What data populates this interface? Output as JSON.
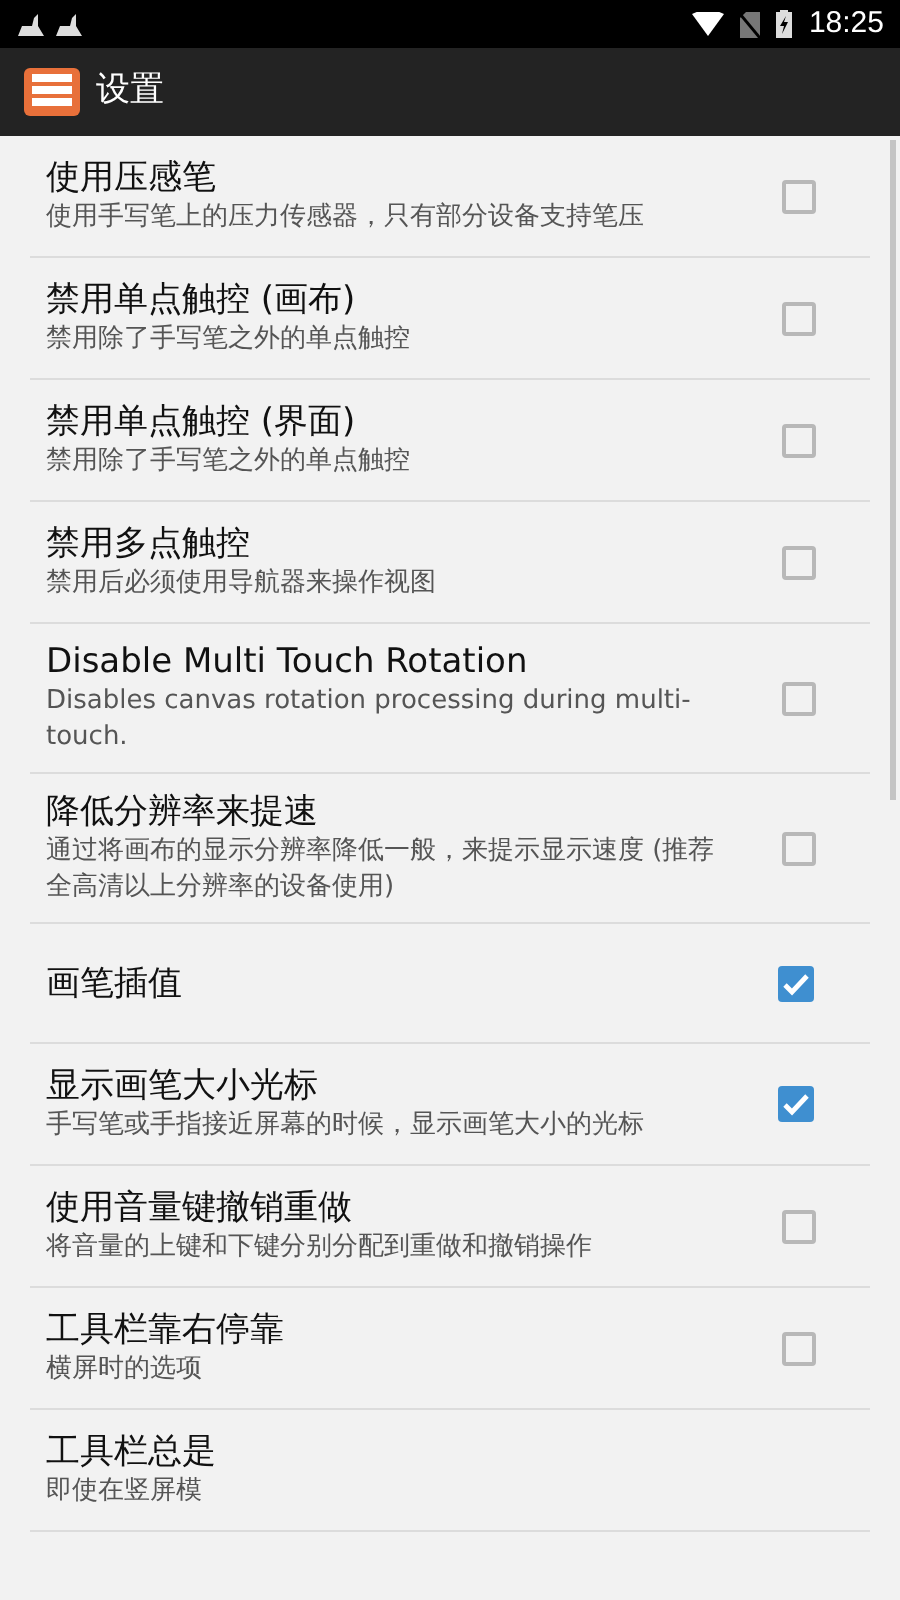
{
  "status_bar": {
    "time": "18:25"
  },
  "app_bar": {
    "title": "设置"
  },
  "settings": [
    {
      "title": "使用压感笔",
      "summary": "使用手写笔上的压力传感器，只有部分设备支持笔压",
      "checked": false
    },
    {
      "title": "禁用单点触控 (画布)",
      "summary": "禁用除了手写笔之外的单点触控",
      "checked": false
    },
    {
      "title": "禁用单点触控 (界面)",
      "summary": "禁用除了手写笔之外的单点触控",
      "checked": false
    },
    {
      "title": "禁用多点触控",
      "summary": "禁用后必须使用导航器来操作视图",
      "checked": false
    },
    {
      "title": "Disable Multi Touch Rotation",
      "summary": "Disables canvas rotation processing during multi-touch.",
      "checked": false
    },
    {
      "title": "降低分辨率来提速",
      "summary": "通过将画布的显示分辨率降低一般，来提示显示速度 (推荐全高清以上分辨率的设备使用)",
      "checked": false
    },
    {
      "title": "画笔插值",
      "checked": true
    },
    {
      "title": "显示画笔大小光标",
      "summary": "手写笔或手指接近屏幕的时候，显示画笔大小的光标",
      "checked": true
    },
    {
      "title": "使用音量键撤销重做",
      "summary": "将音量的上键和下键分别分配到重做和撤销操作",
      "checked": false
    },
    {
      "title": "工具栏靠右停靠",
      "summary": "横屏时的选项",
      "checked": false
    },
    {
      "title": "工具栏总是",
      "summary": "即使在竖屏模"
    }
  ]
}
